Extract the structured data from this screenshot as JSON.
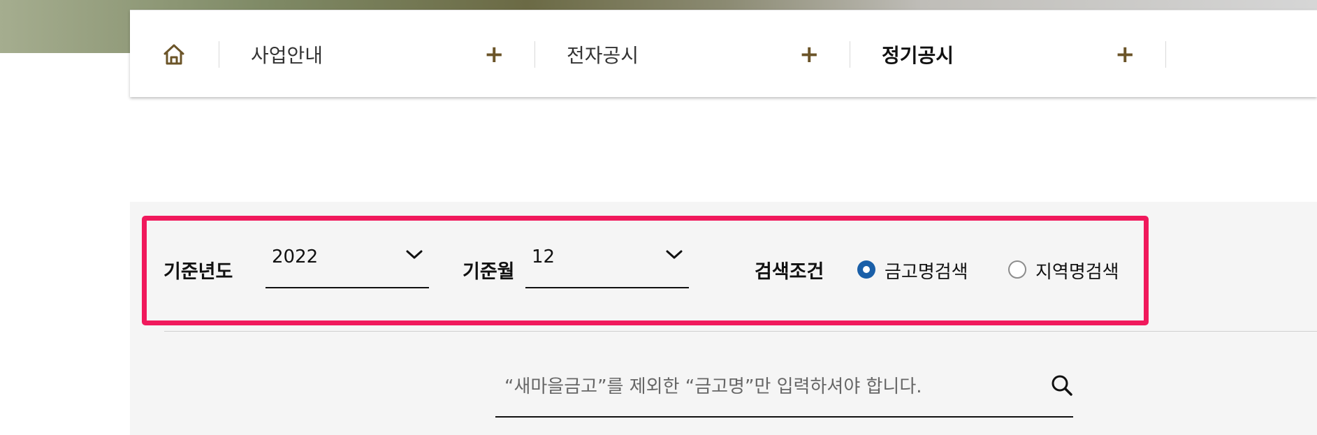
{
  "nav": {
    "home_icon": "home-icon",
    "items": [
      {
        "label": "사업안내",
        "expand": "+"
      },
      {
        "label": "전자공시",
        "expand": "+"
      },
      {
        "label": "정기공시",
        "expand": "+"
      }
    ]
  },
  "filters": {
    "year_label": "기준년도",
    "year_value": "2022",
    "month_label": "기준월",
    "month_value": "12",
    "condition_label": "검색조건",
    "radio_options": [
      {
        "label": "금고명검색",
        "checked": true
      },
      {
        "label": "지역명검색",
        "checked": false
      }
    ]
  },
  "search": {
    "placeholder": "“새마을금고”를 제외한 “금고명”만 입력하셔야 합니다.",
    "value": ""
  },
  "colors": {
    "accent_brown": "#6b5428",
    "highlight": "#f0195c",
    "radio_active": "#1a5fa8"
  }
}
